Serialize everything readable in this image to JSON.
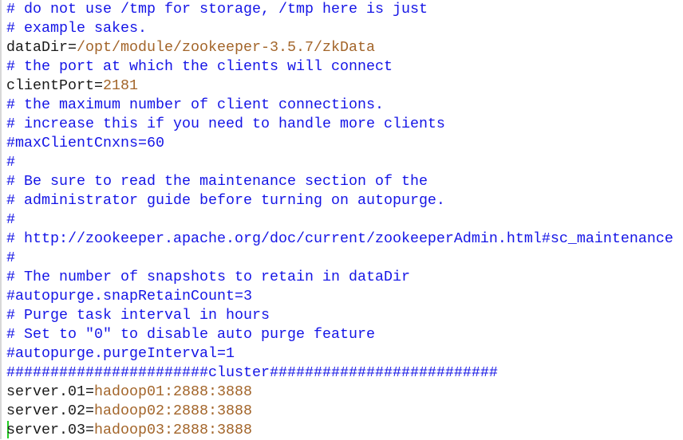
{
  "colors": {
    "comment": "#1515e6",
    "key": "#1a1a1a",
    "value": "#a3652a",
    "cursor": "#22cc22"
  },
  "lines": [
    {
      "type": "comment",
      "text": "# do not use /tmp for storage, /tmp here is just"
    },
    {
      "type": "comment",
      "text": "# example sakes."
    },
    {
      "type": "kv",
      "key": "dataDir=",
      "value": "/opt/module/zookeeper-3.5.7/zkData"
    },
    {
      "type": "comment",
      "text": "# the port at which the clients will connect"
    },
    {
      "type": "kv",
      "key": "clientPort=",
      "value": "2181"
    },
    {
      "type": "comment",
      "text": "# the maximum number of client connections."
    },
    {
      "type": "comment",
      "text": "# increase this if you need to handle more clients"
    },
    {
      "type": "comment",
      "text": "#maxClientCnxns=60"
    },
    {
      "type": "comment",
      "text": "#"
    },
    {
      "type": "comment",
      "text": "# Be sure to read the maintenance section of the"
    },
    {
      "type": "comment",
      "text": "# administrator guide before turning on autopurge."
    },
    {
      "type": "comment",
      "text": "#"
    },
    {
      "type": "comment",
      "text": "# http://zookeeper.apache.org/doc/current/zookeeperAdmin.html#sc_maintenance"
    },
    {
      "type": "comment",
      "text": "#"
    },
    {
      "type": "comment",
      "text": "# The number of snapshots to retain in dataDir"
    },
    {
      "type": "comment",
      "text": "#autopurge.snapRetainCount=3"
    },
    {
      "type": "comment",
      "text": "# Purge task interval in hours"
    },
    {
      "type": "comment",
      "text": "# Set to \"0\" to disable auto purge feature"
    },
    {
      "type": "comment",
      "text": "#autopurge.purgeInterval=1"
    },
    {
      "type": "comment",
      "text": "#######################cluster##########################"
    },
    {
      "type": "kv",
      "key": "server.01=",
      "value": "hadoop01:2888:3888"
    },
    {
      "type": "kv",
      "key": "server.02=",
      "value": "hadoop02:2888:3888"
    },
    {
      "type": "kv",
      "key": "server.03=",
      "value": "hadoop03:2888:3888"
    }
  ]
}
